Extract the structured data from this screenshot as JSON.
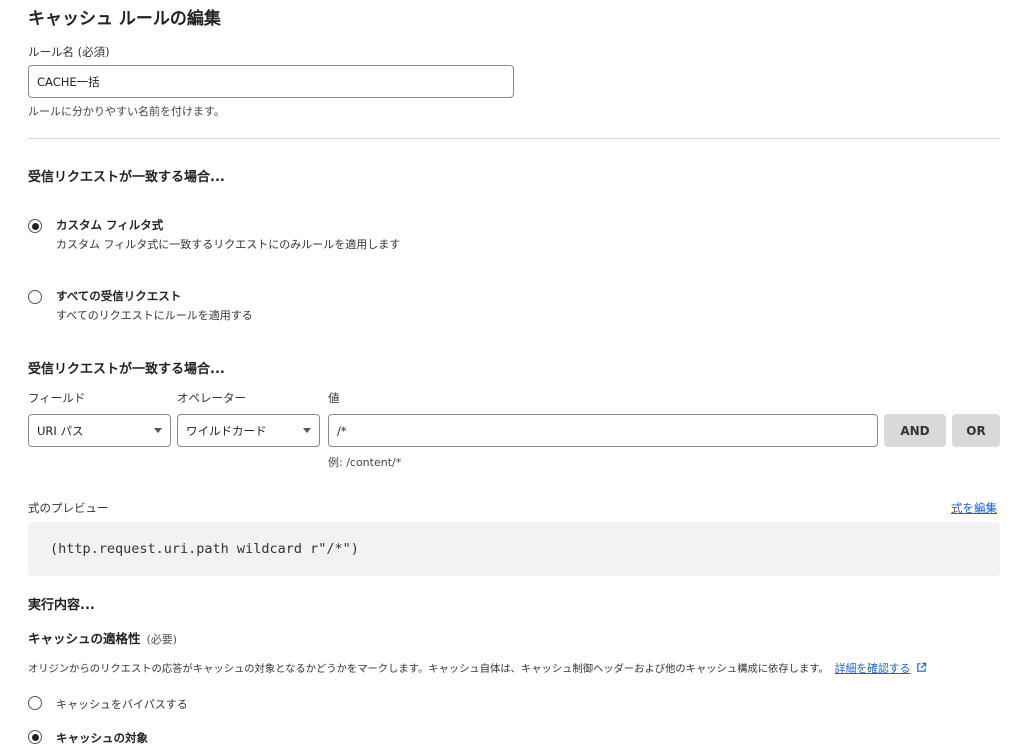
{
  "page": {
    "title": "キャッシュ ルールの編集"
  },
  "rule_name": {
    "label": "ルール名 (必須)",
    "value": "CACHE一括",
    "help": "ルールに分かりやすい名前を付けます。"
  },
  "match": {
    "heading": "受信リクエストが一致する場合...",
    "options": [
      {
        "title": "カスタム フィルタ式",
        "description": "カスタム フィルタ式に一致するリクエストにのみルールを適用します",
        "selected": true
      },
      {
        "title": "すべての受信リクエスト",
        "description": "すべてのリクエストにルールを適用する",
        "selected": false
      }
    ]
  },
  "filter": {
    "heading": "受信リクエストが一致する場合...",
    "field_label": "フィールド",
    "operator_label": "オペレーター",
    "value_label": "値",
    "field_value": "URI パス",
    "operator_value": "ワイルドカード",
    "value": "/*",
    "value_hint": "例: /content/*",
    "and_label": "AND",
    "or_label": "OR"
  },
  "preview": {
    "label": "式のプレビュー",
    "edit_link": "式を編集",
    "expression": "(http.request.uri.path wildcard r\"/*\")"
  },
  "action": {
    "heading": "実行内容...",
    "eligibility_title": "キャッシュの適格性",
    "eligibility_required": "(必要)",
    "eligibility_desc": "オリジンからのリクエストの応答がキャッシュの対象となるかどうかをマークします。キャッシュ自体は、キャッシュ制御ヘッダーおよび他のキャッシュ構成に依存します。",
    "details_link": "詳細を確認する",
    "options": [
      {
        "label": "キャッシュをバイパスする",
        "selected": false
      },
      {
        "label": "キャッシュの対象",
        "selected": true
      }
    ]
  }
}
